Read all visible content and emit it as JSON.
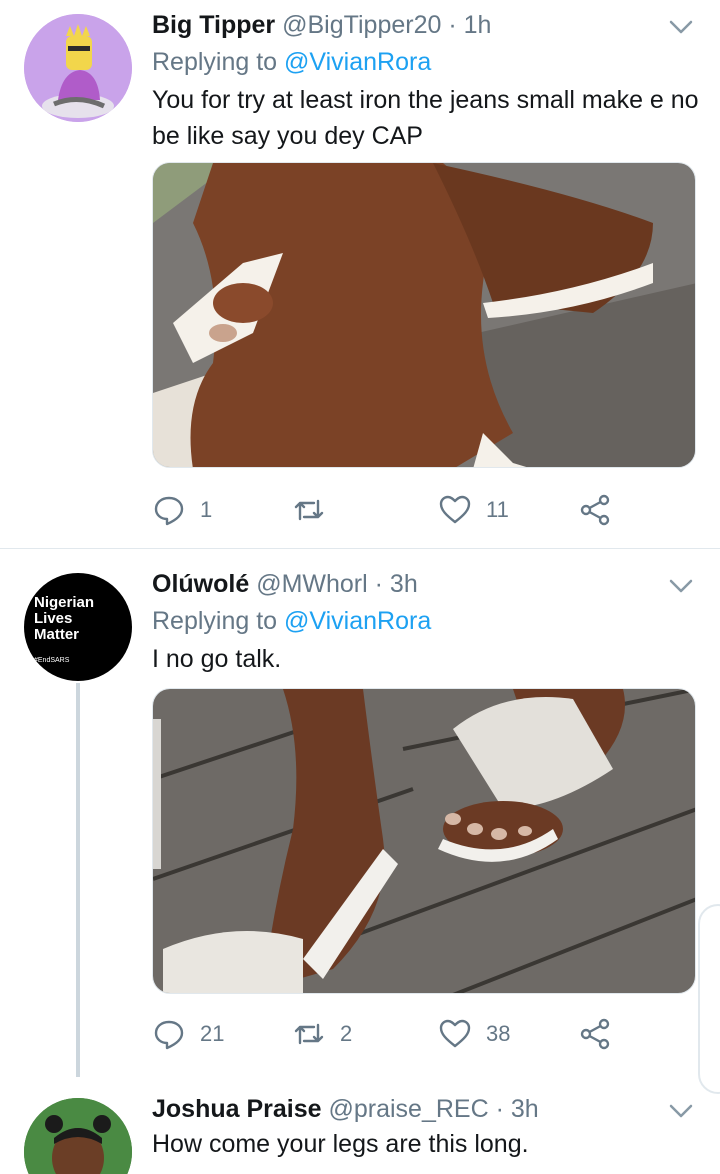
{
  "tweets": [
    {
      "name": "Big Tipper",
      "handle": "@BigTipper20",
      "separator": "·",
      "time": "1h",
      "replying_prefix": "Replying to",
      "replying_to": "@VivianRora",
      "text": "You for try at least iron the jeans small make e no be like say you dey CAP",
      "avatar_icon": "cartoon-character-avatar",
      "media_icon": "foot-in-white-slide-photo",
      "actions": {
        "reply_count": "1",
        "retweet_count": "",
        "like_count": "11"
      }
    },
    {
      "name": "Olúwolé",
      "handle": "@MWhorl",
      "separator": "·",
      "time": "3h",
      "replying_prefix": "Replying to",
      "replying_to": "@VivianRora",
      "text": "I no go talk.",
      "avatar_text": {
        "line1": "Nigerian",
        "line2": "Lives",
        "line3": "Matter",
        "tag": "#EndSARS"
      },
      "media_icon": "white-sandals-on-deck-photo",
      "actions": {
        "reply_count": "21",
        "retweet_count": "2",
        "like_count": "38"
      }
    },
    {
      "name": "Joshua Praise",
      "handle": "@praise_REC",
      "separator": "·",
      "time": "3h",
      "text": "How come your legs are this long.",
      "avatar_icon": "child-photo-avatar"
    }
  ],
  "colors": {
    "link": "#1da1f2",
    "muted": "#657786",
    "divider": "#e1e8ed",
    "thread": "#ccd6dd"
  }
}
